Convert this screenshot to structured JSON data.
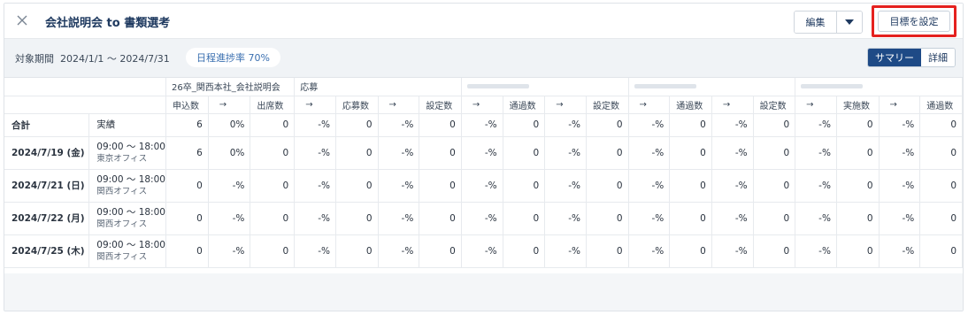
{
  "header": {
    "title": "会社説明会 to 書類選考",
    "edit_label": "編集",
    "goal_label": "目標を設定"
  },
  "subbar": {
    "period_label": "対象期間",
    "period_value": "2024/1/1 〜 2024/7/31",
    "progress_label": "日程進捗率 70%",
    "view_summary": "サマリー",
    "view_detail": "詳細"
  },
  "table": {
    "groups": [
      "26卒_関西本社_会社説明会",
      "応募",
      "",
      "",
      ""
    ],
    "columns": [
      "申込数",
      "→",
      "出席数",
      "→",
      "応募数",
      "→",
      "設定数",
      "→",
      "通過数",
      "→",
      "設定数",
      "→",
      "通過数",
      "→",
      "設定数",
      "→",
      "実施数",
      "→",
      "通過数"
    ],
    "total": {
      "label": "合計",
      "sub": "実績",
      "cells": [
        "6",
        "0%",
        "0",
        "-%",
        "0",
        "-%",
        "0",
        "-%",
        "0",
        "-%",
        "0",
        "-%",
        "0",
        "-%",
        "0",
        "-%",
        "0",
        "-%",
        "0"
      ]
    },
    "rows": [
      {
        "date": "2024/7/19 (金)",
        "time": "09:00 〜 18:00",
        "office": "東京オフィス",
        "cells": [
          "6",
          "0%",
          "0",
          "-%",
          "0",
          "-%",
          "0",
          "-%",
          "0",
          "-%",
          "0",
          "-%",
          "0",
          "-%",
          "0",
          "-%",
          "0",
          "-%",
          "0"
        ]
      },
      {
        "date": "2024/7/21 (日)",
        "time": "09:00 〜 18:00",
        "office": "関西オフィス",
        "cells": [
          "0",
          "-%",
          "0",
          "-%",
          "0",
          "-%",
          "0",
          "-%",
          "0",
          "-%",
          "0",
          "-%",
          "0",
          "-%",
          "0",
          "-%",
          "0",
          "-%",
          "0"
        ]
      },
      {
        "date": "2024/7/22 (月)",
        "time": "09:00 〜 18:00",
        "office": "関西オフィス",
        "cells": [
          "0",
          "-%",
          "0",
          "-%",
          "0",
          "-%",
          "0",
          "-%",
          "0",
          "-%",
          "0",
          "-%",
          "0",
          "-%",
          "0",
          "-%",
          "0",
          "-%",
          "0"
        ]
      },
      {
        "date": "2024/7/25 (木)",
        "time": "09:00 〜 18:00",
        "office": "関西オフィス",
        "cells": [
          "0",
          "-%",
          "0",
          "-%",
          "0",
          "-%",
          "0",
          "-%",
          "0",
          "-%",
          "0",
          "-%",
          "0",
          "-%",
          "0",
          "-%",
          "0",
          "-%",
          "0"
        ]
      }
    ]
  },
  "colors": {
    "accent": "#1e4a86",
    "highlight": "#e5211f",
    "pill_text": "#3a6fb0"
  }
}
